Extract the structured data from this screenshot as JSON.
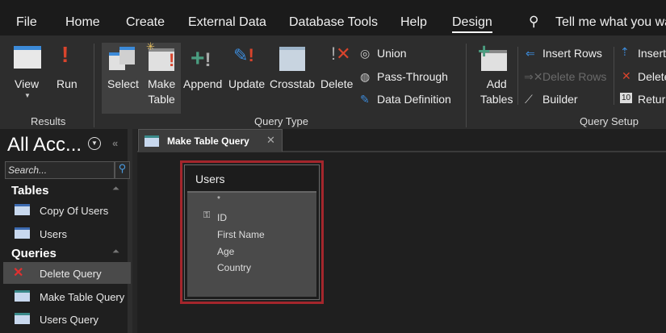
{
  "menu": {
    "items": [
      "File",
      "Home",
      "Create",
      "External Data",
      "Database Tools",
      "Help",
      "Design"
    ],
    "active": "Design",
    "tell_me": "Tell me what you wa"
  },
  "ribbon": {
    "results": {
      "label": "Results",
      "view": "View",
      "run": "Run"
    },
    "query_type": {
      "label": "Query Type",
      "select": "Select",
      "make_table_1": "Make",
      "make_table_2": "Table",
      "append": "Append",
      "update": "Update",
      "crosstab": "Crosstab",
      "delete": "Delete",
      "union": "Union",
      "pass_through": "Pass-Through",
      "data_definition": "Data Definition"
    },
    "query_setup": {
      "label": "Query Setup",
      "add_tables_1": "Add",
      "add_tables_2": "Tables",
      "insert_rows": "Insert Rows",
      "delete_rows": "Delete Rows",
      "builder": "Builder",
      "insert_cols": "Insert",
      "delete_cols": "Delete",
      "return": "Return"
    }
  },
  "nav": {
    "title": "All Acc...",
    "search_placeholder": "Search...",
    "tables_header": "Tables",
    "tables": [
      "Copy Of Users",
      "Users"
    ],
    "queries_header": "Queries",
    "queries": [
      "Delete Query",
      "Make Table Query",
      "Users Query"
    ],
    "selected": "Delete Query"
  },
  "doc": {
    "tab": "Make Table Query",
    "table": {
      "name": "Users",
      "fields": [
        "*",
        "ID",
        "First Name",
        "Age",
        "Country"
      ]
    }
  },
  "colors": {
    "accent_red": "#d13438",
    "selection_border": "#a4262c"
  }
}
